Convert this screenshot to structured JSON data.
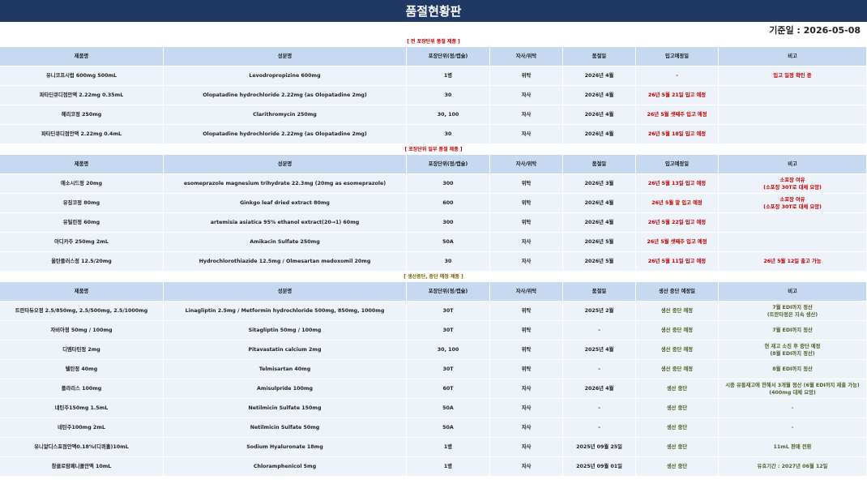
{
  "title": "품절현황판",
  "date_label": "기준일 : 2026-05-08",
  "colors": {
    "title_bg": "#1f3864",
    "header_bg": "#c5d9f1",
    "row_bg": "#eef3f9",
    "red": "#c00000",
    "olive": "#4f6228"
  },
  "sections": [
    {
      "label": "[ 전 포장단위 품절 제품 ]",
      "headers": [
        "제품명",
        "성분명",
        "포장단위(정/캡슐)",
        "자사/위탁",
        "품절일",
        "입고예정일",
        "비고"
      ],
      "rows": [
        [
          "유니코프시럽 600mg 500mL",
          "Levodropropizine 600mg",
          "1병",
          "위탁",
          "2026년 4월",
          "-",
          "입고 일정 확인 중"
        ],
        [
          "파타딘큐디점안액 2.22mg 0.35mL",
          "Olopatadine hydrochloride 2.22mg (as Olopatadine 2mg)",
          "30",
          "자사",
          "2026년 4월",
          "26년 5월 21일 입고 예정",
          ""
        ],
        [
          "헤리코정 250mg",
          "Clarithromycin 250mg",
          "30, 100",
          "자사",
          "2026년 4월",
          "26년 5월 셋째주 입고 예정",
          ""
        ],
        [
          "파타딘큐디점안액 2.22mg 0.4mL",
          "Olopatadine hydrochloride 2.22mg (as Olopatadine 2mg)",
          "30",
          "자사",
          "2026년 4월",
          "26년 5월 18일 입고 예정",
          ""
        ]
      ]
    },
    {
      "label": "[ 포장단위 일부 품절 제품 ]",
      "headers": [
        "제품명",
        "성분명",
        "포장단위(정/캡슐)",
        "자사/위탁",
        "품절일",
        "입고예정일",
        "비고"
      ],
      "rows": [
        [
          "에소시드정 20mg",
          "esomeprazole magnesium trihydrate 22.3mg (20mg as esomeprazole)",
          "300",
          "위탁",
          "2026년 3월",
          "26년 5월 13일 입고 예정",
          "소포장 여유\n(소포장 30T로 대체 요망)"
        ],
        [
          "유징코정 80mg",
          "Ginkgo leaf dried extract 80mg",
          "600",
          "위탁",
          "2026년 4월",
          "26년 5월 말 입고 예정",
          "소포장 여유\n(소포장 30T로 대체 요망)"
        ],
        [
          "유틸린정 60mg",
          "artemisia asiatica 95% ethanol extract(20→1) 60mg",
          "300",
          "위탁",
          "2026년 4월",
          "26년 5월 22일 입고 예정",
          ""
        ],
        [
          "아디카주 250mg 2mL",
          "Amikacin Sulfate 250mg",
          "50A",
          "자사",
          "2026년 5월",
          "26년 5월 셋째주 입고 예정",
          ""
        ],
        [
          "올탄플러스정 12.5/20mg",
          "Hydrochlorothiazide 12.5mg /  Olmesartan medoxomil 20mg",
          "30",
          "자사",
          "2026년 5월",
          "26년 5월 11일 입고 예정",
          "26년 5월 12일 출고 가능"
        ]
      ]
    },
    {
      "label": "[ 생산중단, 중단 예정 제품 ]",
      "headers": [
        "제품명",
        "성분명",
        "포장단위(정/캡슐)",
        "자사/위탁",
        "품절일",
        "생산 중단 예정일",
        "비고"
      ],
      "rows": [
        [
          "트란타듀오정 2.5/850mg, 2.5/500mg, 2.5/1000mg",
          "Linagliptin 2.5mg / Metformin hydrochloride 500mg, 850mg, 1000mg",
          "30T",
          "위탁",
          "2025년 2월",
          "생산 중단 예정",
          "7월 EDI까지 정산\n(트란타정은 지속 생산)"
        ],
        [
          "자비아정 50mg / 100mg",
          "Sitagliptin 50mg / 100mg",
          "30T",
          "위탁",
          "-",
          "생산 중단 예정",
          "7월 EDI까지 정산"
        ],
        [
          "디엠타틴정 2mg",
          "Pitavastatin calcium 2mg",
          "30, 100",
          "위탁",
          "2025년 4월",
          "생산 중단 예정",
          "현 재고 소진 후 중단 예정\n(8월 EDI까지 정산)"
        ],
        [
          "텔탄정 40mg",
          "Telmisartan 40mg",
          "30T",
          "위탁",
          "-",
          "생산 중단 예정",
          "8월 EDI까지 정산"
        ],
        [
          "플라리스 100mg",
          "Amisulpride 100mg",
          "60T",
          "자사",
          "2026년 4월",
          "생산 중단",
          "시중 유통재고에 한해서 3개월 정산 (6월 EDI까지 제출 가능)\n(400mg 대체 요망)"
        ],
        [
          "네틴주150mg 1.5mL",
          "Netilmicin Sulfate 150mg",
          "50A",
          "자사",
          "-",
          "생산 중단",
          "-"
        ],
        [
          "네틴주100mg 2mL",
          "Netilmicin Sulfate 50mg",
          "50A",
          "자사",
          "-",
          "생산 중단",
          "-"
        ],
        [
          "유니알디스포점안액0.18%(디퀴홀)10mL",
          "Sodium Hyaluronate 18mg",
          "1병",
          "자사",
          "2025년 09월 25일",
          "생산 중단",
          "11mL 판매 전환"
        ],
        [
          "참클로람페니콜안액 10mL",
          "Chloramphenicol 5mg",
          "1병",
          "자사",
          "2025년 09월 01일",
          "생산 중단",
          "유효기간 : 2027년 06월 12일"
        ]
      ]
    }
  ]
}
